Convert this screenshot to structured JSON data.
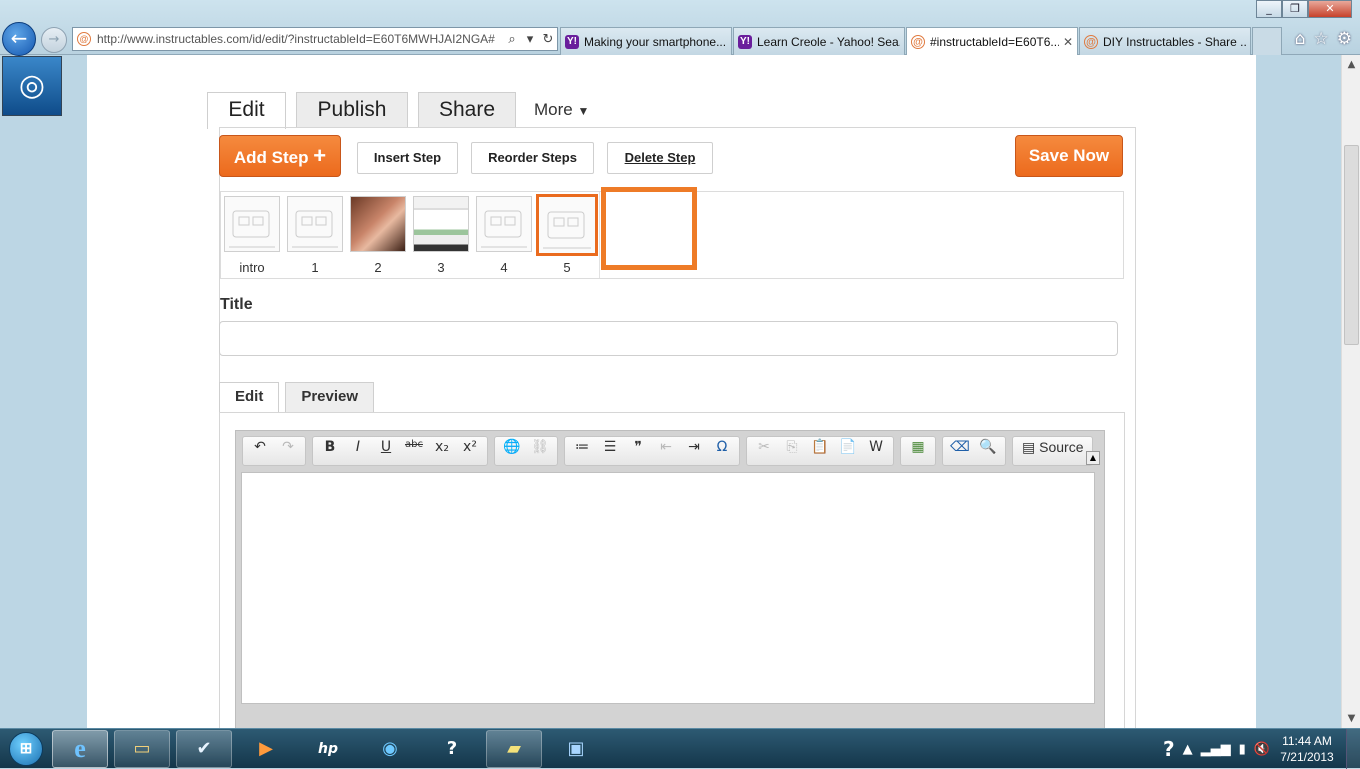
{
  "browser": {
    "url": "http://www.instructables.com/id/edit/?instructableId=E60T6MWHJAI2NGA#",
    "tabs": [
      {
        "title": "Making your smartphone...",
        "favicon": "yahoo",
        "active": false,
        "closable": false
      },
      {
        "title": "Learn Creole - Yahoo! Sea...",
        "favicon": "yahoo",
        "active": false,
        "closable": false
      },
      {
        "title": "#instructableId=E60T6...",
        "favicon": "instructables",
        "active": true,
        "closable": true
      },
      {
        "title": "DIY Instructables - Share ...",
        "favicon": "instructables",
        "active": false,
        "closable": false
      }
    ],
    "icons": [
      "back-icon",
      "forward-icon",
      "search-icon",
      "refresh-icon",
      "home-icon",
      "favorites-star-icon",
      "tools-gear-icon"
    ]
  },
  "editor": {
    "tabs": {
      "edit": "Edit",
      "publish": "Publish",
      "share": "Share",
      "more": "More"
    },
    "toolbar": {
      "add_step": "Add Step",
      "add_step_plus": "+",
      "insert_step": "Insert Step",
      "reorder_steps": "Reorder Steps",
      "delete_step": "Delete Step",
      "save_now": "Save Now"
    },
    "steps": [
      {
        "label": "intro",
        "kind": "robot"
      },
      {
        "label": "1",
        "kind": "robot"
      },
      {
        "label": "2",
        "kind": "photo"
      },
      {
        "label": "3",
        "kind": "screenshot"
      },
      {
        "label": "4",
        "kind": "robot"
      },
      {
        "label": "5",
        "kind": "robot",
        "selected": true
      }
    ],
    "title_label": "Title",
    "title_value": "",
    "subtabs": {
      "edit": "Edit",
      "preview": "Preview"
    },
    "rte": {
      "source_label": "Source",
      "body": ""
    }
  },
  "colors": {
    "accent": "#ec6a1d",
    "selection": "#ee7b27"
  },
  "taskbar": {
    "clock_time": "11:44 AM",
    "clock_date": "7/21/2013",
    "apps": [
      "internet-explorer",
      "file-explorer",
      "app-checkmark",
      "media-player",
      "hp-help",
      "globe-app",
      "help-question",
      "sticky-notes",
      "photo-viewer"
    ]
  }
}
